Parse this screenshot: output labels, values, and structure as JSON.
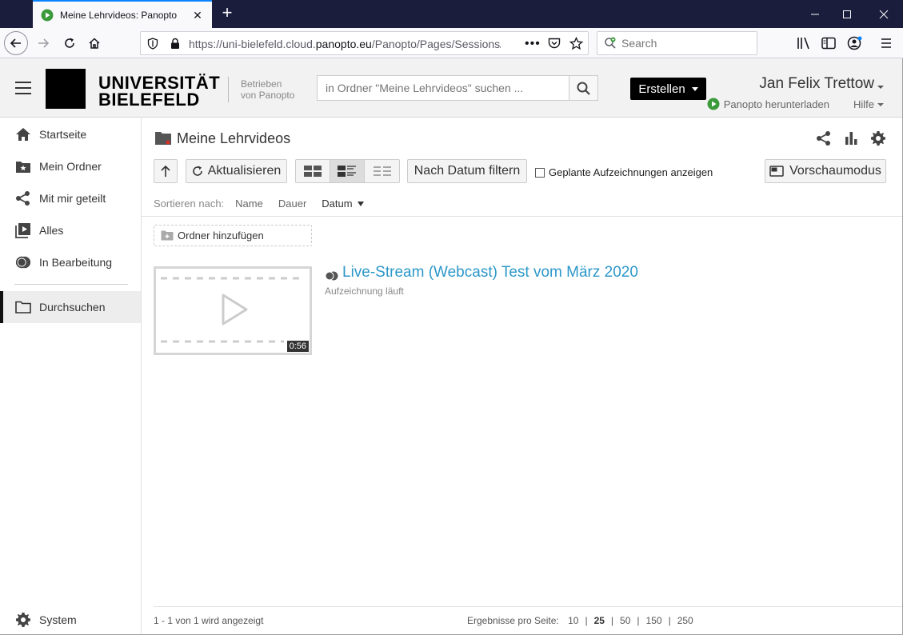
{
  "browser": {
    "tab_title": "Meine Lehrvideos: Panopto",
    "url_prefix": "https://uni-bielefeld.cloud.",
    "url_domain": "panopto.eu",
    "url_suffix": "/Panopto/Pages/Sessions/",
    "search_placeholder": "Search"
  },
  "header": {
    "logo_line1": "UNIVERSITÄT",
    "logo_line2": "BIELEFELD",
    "powered_line1": "Betrieben",
    "powered_line2": "von Panopto",
    "search_placeholder": "in Ordner \"Meine Lehrvideos\" suchen ...",
    "create_label": "Erstellen",
    "user_name": "Jan Felix Trettow",
    "download_label": "Panopto herunterladen",
    "help_label": "Hilfe"
  },
  "sidebar": {
    "items": [
      {
        "label": "Startseite"
      },
      {
        "label": "Mein Ordner"
      },
      {
        "label": "Mit mir geteilt"
      },
      {
        "label": "Alles"
      },
      {
        "label": "In Bearbeitung"
      },
      {
        "label": "Durchsuchen"
      }
    ],
    "system_label": "System"
  },
  "main": {
    "folder_title": "Meine Lehrvideos",
    "refresh_label": "Aktualisieren",
    "date_filter_label": "Nach Datum filtern",
    "scheduled_label": "Geplante Aufzeichnungen anzeigen",
    "preview_label": "Vorschaumodus",
    "sort_label": "Sortieren nach:",
    "sort_options": [
      "Name",
      "Dauer",
      "Datum"
    ],
    "add_folder_label": "Ordner hinzufügen",
    "session": {
      "title": "Live-Stream (Webcast) Test vom März 2020",
      "status": "Aufzeichnung läuft",
      "duration": "0:56"
    },
    "footer": {
      "count_text": "1 - 1 von 1 wird angezeigt",
      "per_page_label": "Ergebnisse pro Seite:",
      "page_sizes": [
        "10",
        "25",
        "50",
        "150",
        "250"
      ]
    }
  },
  "colors": {
    "accent_link": "#2d98c9",
    "tab_bar": "#1b1d3d",
    "create_button": "#000000"
  }
}
